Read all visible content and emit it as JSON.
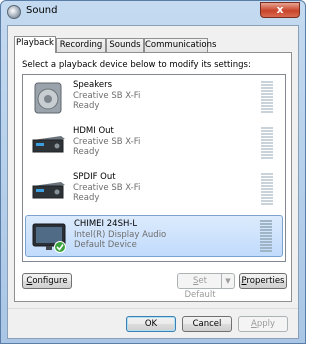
{
  "window": {
    "title": "Sound",
    "close_label": "x"
  },
  "tabs": [
    {
      "label": "Playback"
    },
    {
      "label": "Recording"
    },
    {
      "label": "Sounds"
    },
    {
      "label": "Communications"
    }
  ],
  "instruction": "Select a playback device below to modify its settings:",
  "devices": [
    {
      "name": "Speakers",
      "line2": "Creative SB X-Fi",
      "status": "Ready",
      "icon": "speaker-icon",
      "selected": false
    },
    {
      "name": "HDMI Out",
      "line2": "Creative SB X-Fi",
      "status": "Ready",
      "icon": "receiver-icon",
      "selected": false
    },
    {
      "name": "SPDIF Out",
      "line2": "Creative SB X-Fi",
      "status": "Ready",
      "icon": "receiver-icon",
      "selected": false
    },
    {
      "name": "CHIMEI 24SH-L",
      "line2": "Intel(R) Display Audio",
      "status": "Default Device",
      "icon": "monitor-icon",
      "selected": true
    }
  ],
  "buttons": {
    "configure": {
      "accel": "C",
      "rest": "onfigure"
    },
    "set_default": {
      "accel": "S",
      "rest": "et Default"
    },
    "properties": {
      "accel": "P",
      "rest": "roperties"
    },
    "ok": "OK",
    "cancel": "Cancel",
    "apply": {
      "accel": "A",
      "rest": "pply"
    }
  }
}
